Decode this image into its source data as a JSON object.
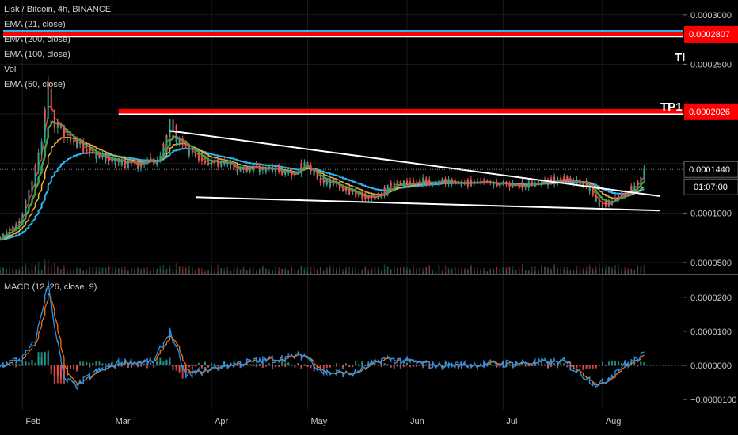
{
  "header": {
    "title": "Lisk / Bitcoin, 4h, BINANCE",
    "indicators": [
      "EMA (21, close)",
      "EMA (200, close)",
      "EMA (100, close)",
      "Vol",
      "EMA (50, close)"
    ]
  },
  "macd_label": "MACD (12, 26, close, 9)",
  "annotations": {
    "tp1": "TP1",
    "tp2_partial": "TI"
  },
  "countdown": "01:07:00",
  "colors": {
    "background": "#000000",
    "up": "#26a69a",
    "down": "#ef5350",
    "ema21": "#e53935",
    "ema50": "#43a047",
    "ema100": "#f5b041",
    "ema200": "#29b6f6",
    "macd": "#2196f3",
    "signal": "#ff6d00",
    "target": "#ff0000",
    "trendline": "#ffffff"
  },
  "chart_data": [
    {
      "type": "candlestick",
      "title": "Lisk / Bitcoin, 4h, BINANCE",
      "x_ticks": [
        "Feb",
        "Mar",
        "Apr",
        "May",
        "Jun",
        "Jul",
        "Aug"
      ],
      "y_ticks": [
        "0.0000500",
        "0.0001000",
        "0.0001500",
        "0.0002000",
        "0.0002500",
        "0.0003000"
      ],
      "ylim": [
        3.8e-05,
        0.000315
      ],
      "price_labels": [
        {
          "value": 0.0002807,
          "text": "0.0002807",
          "kind": "target"
        },
        {
          "value": 0.0002026,
          "text": "0.0002026",
          "kind": "target"
        },
        {
          "value": 0.000144,
          "text": "0.0001440",
          "kind": "last"
        }
      ],
      "price_path": [
        [
          "2019-01-25",
          7.5e-05
        ],
        [
          "2019-01-31",
          9e-05
        ],
        [
          "2019-02-04",
          0.00013
        ],
        [
          "2019-02-07",
          0.00017
        ],
        [
          "2019-02-09",
          0.00023
        ],
        [
          "2019-02-11",
          0.00019
        ],
        [
          "2019-02-15",
          0.000175
        ],
        [
          "2019-02-20",
          0.000165
        ],
        [
          "2019-02-26",
          0.000155
        ],
        [
          "2019-03-04",
          0.00015
        ],
        [
          "2019-03-10",
          0.000148
        ],
        [
          "2019-03-16",
          0.000155
        ],
        [
          "2019-03-19",
          0.00019
        ],
        [
          "2019-03-22",
          0.00017
        ],
        [
          "2019-03-28",
          0.000155
        ],
        [
          "2019-04-10",
          0.000145
        ],
        [
          "2019-04-20",
          0.000145
        ],
        [
          "2019-04-28",
          0.000138
        ],
        [
          "2019-04-30",
          0.000155
        ],
        [
          "2019-05-04",
          0.000135
        ],
        [
          "2019-05-15",
          0.00012
        ],
        [
          "2019-05-22",
          0.000115
        ],
        [
          "2019-05-28",
          0.00013
        ],
        [
          "2019-06-05",
          0.000132
        ],
        [
          "2019-06-20",
          0.00013
        ],
        [
          "2019-07-05",
          0.000128
        ],
        [
          "2019-07-15",
          0.000131
        ],
        [
          "2019-07-20",
          0.000135
        ],
        [
          "2019-07-27",
          0.00013
        ],
        [
          "2019-07-31",
          0.000108
        ],
        [
          "2019-08-04",
          0.00011
        ],
        [
          "2019-08-08",
          0.00012
        ],
        [
          "2019-08-12",
          0.00013
        ],
        [
          "2019-08-14",
          0.000144
        ]
      ],
      "trendlines": [
        {
          "from": [
            "2019-03-19",
            0.000183
          ],
          "to": [
            "2019-08-19",
            0.000117
          ]
        },
        {
          "from": [
            "2019-03-27",
            0.000116
          ],
          "to": [
            "2019-08-19",
            0.0001025
          ]
        }
      ],
      "target_lines": [
        {
          "value": 0.0002807,
          "from": "2019-01-26"
        },
        {
          "value": 0.0002026,
          "from": "2019-03-03"
        }
      ]
    },
    {
      "type": "line",
      "title": "MACD (12, 26, close, 9)",
      "y_ticks": [
        "−0.0000100",
        "0.0000000",
        "0.0000100",
        "0.0000200"
      ],
      "ylim": [
        -1.3e-05,
        2.6e-05
      ],
      "macd_path": [
        [
          "2019-01-25",
          0
        ],
        [
          "2019-02-01",
          2e-06
        ],
        [
          "2019-02-05",
          7e-06
        ],
        [
          "2019-02-09",
          2.4e-05
        ],
        [
          "2019-02-11",
          1.2e-05
        ],
        [
          "2019-02-14",
          -4e-06
        ],
        [
          "2019-02-18",
          -6e-06
        ],
        [
          "2019-02-24",
          -2e-06
        ],
        [
          "2019-03-04",
          1e-06
        ],
        [
          "2019-03-14",
          1e-06
        ],
        [
          "2019-03-19",
          1e-05
        ],
        [
          "2019-03-24",
          -3e-06
        ],
        [
          "2019-04-05",
          0
        ],
        [
          "2019-04-30",
          3e-06
        ],
        [
          "2019-05-06",
          -2e-06
        ],
        [
          "2019-05-15",
          -2.5e-06
        ],
        [
          "2019-05-25",
          2e-06
        ],
        [
          "2019-06-10",
          0
        ],
        [
          "2019-07-20",
          1e-06
        ],
        [
          "2019-07-31",
          -6e-06
        ],
        [
          "2019-08-06",
          -1e-06
        ],
        [
          "2019-08-14",
          3e-06
        ]
      ]
    }
  ]
}
